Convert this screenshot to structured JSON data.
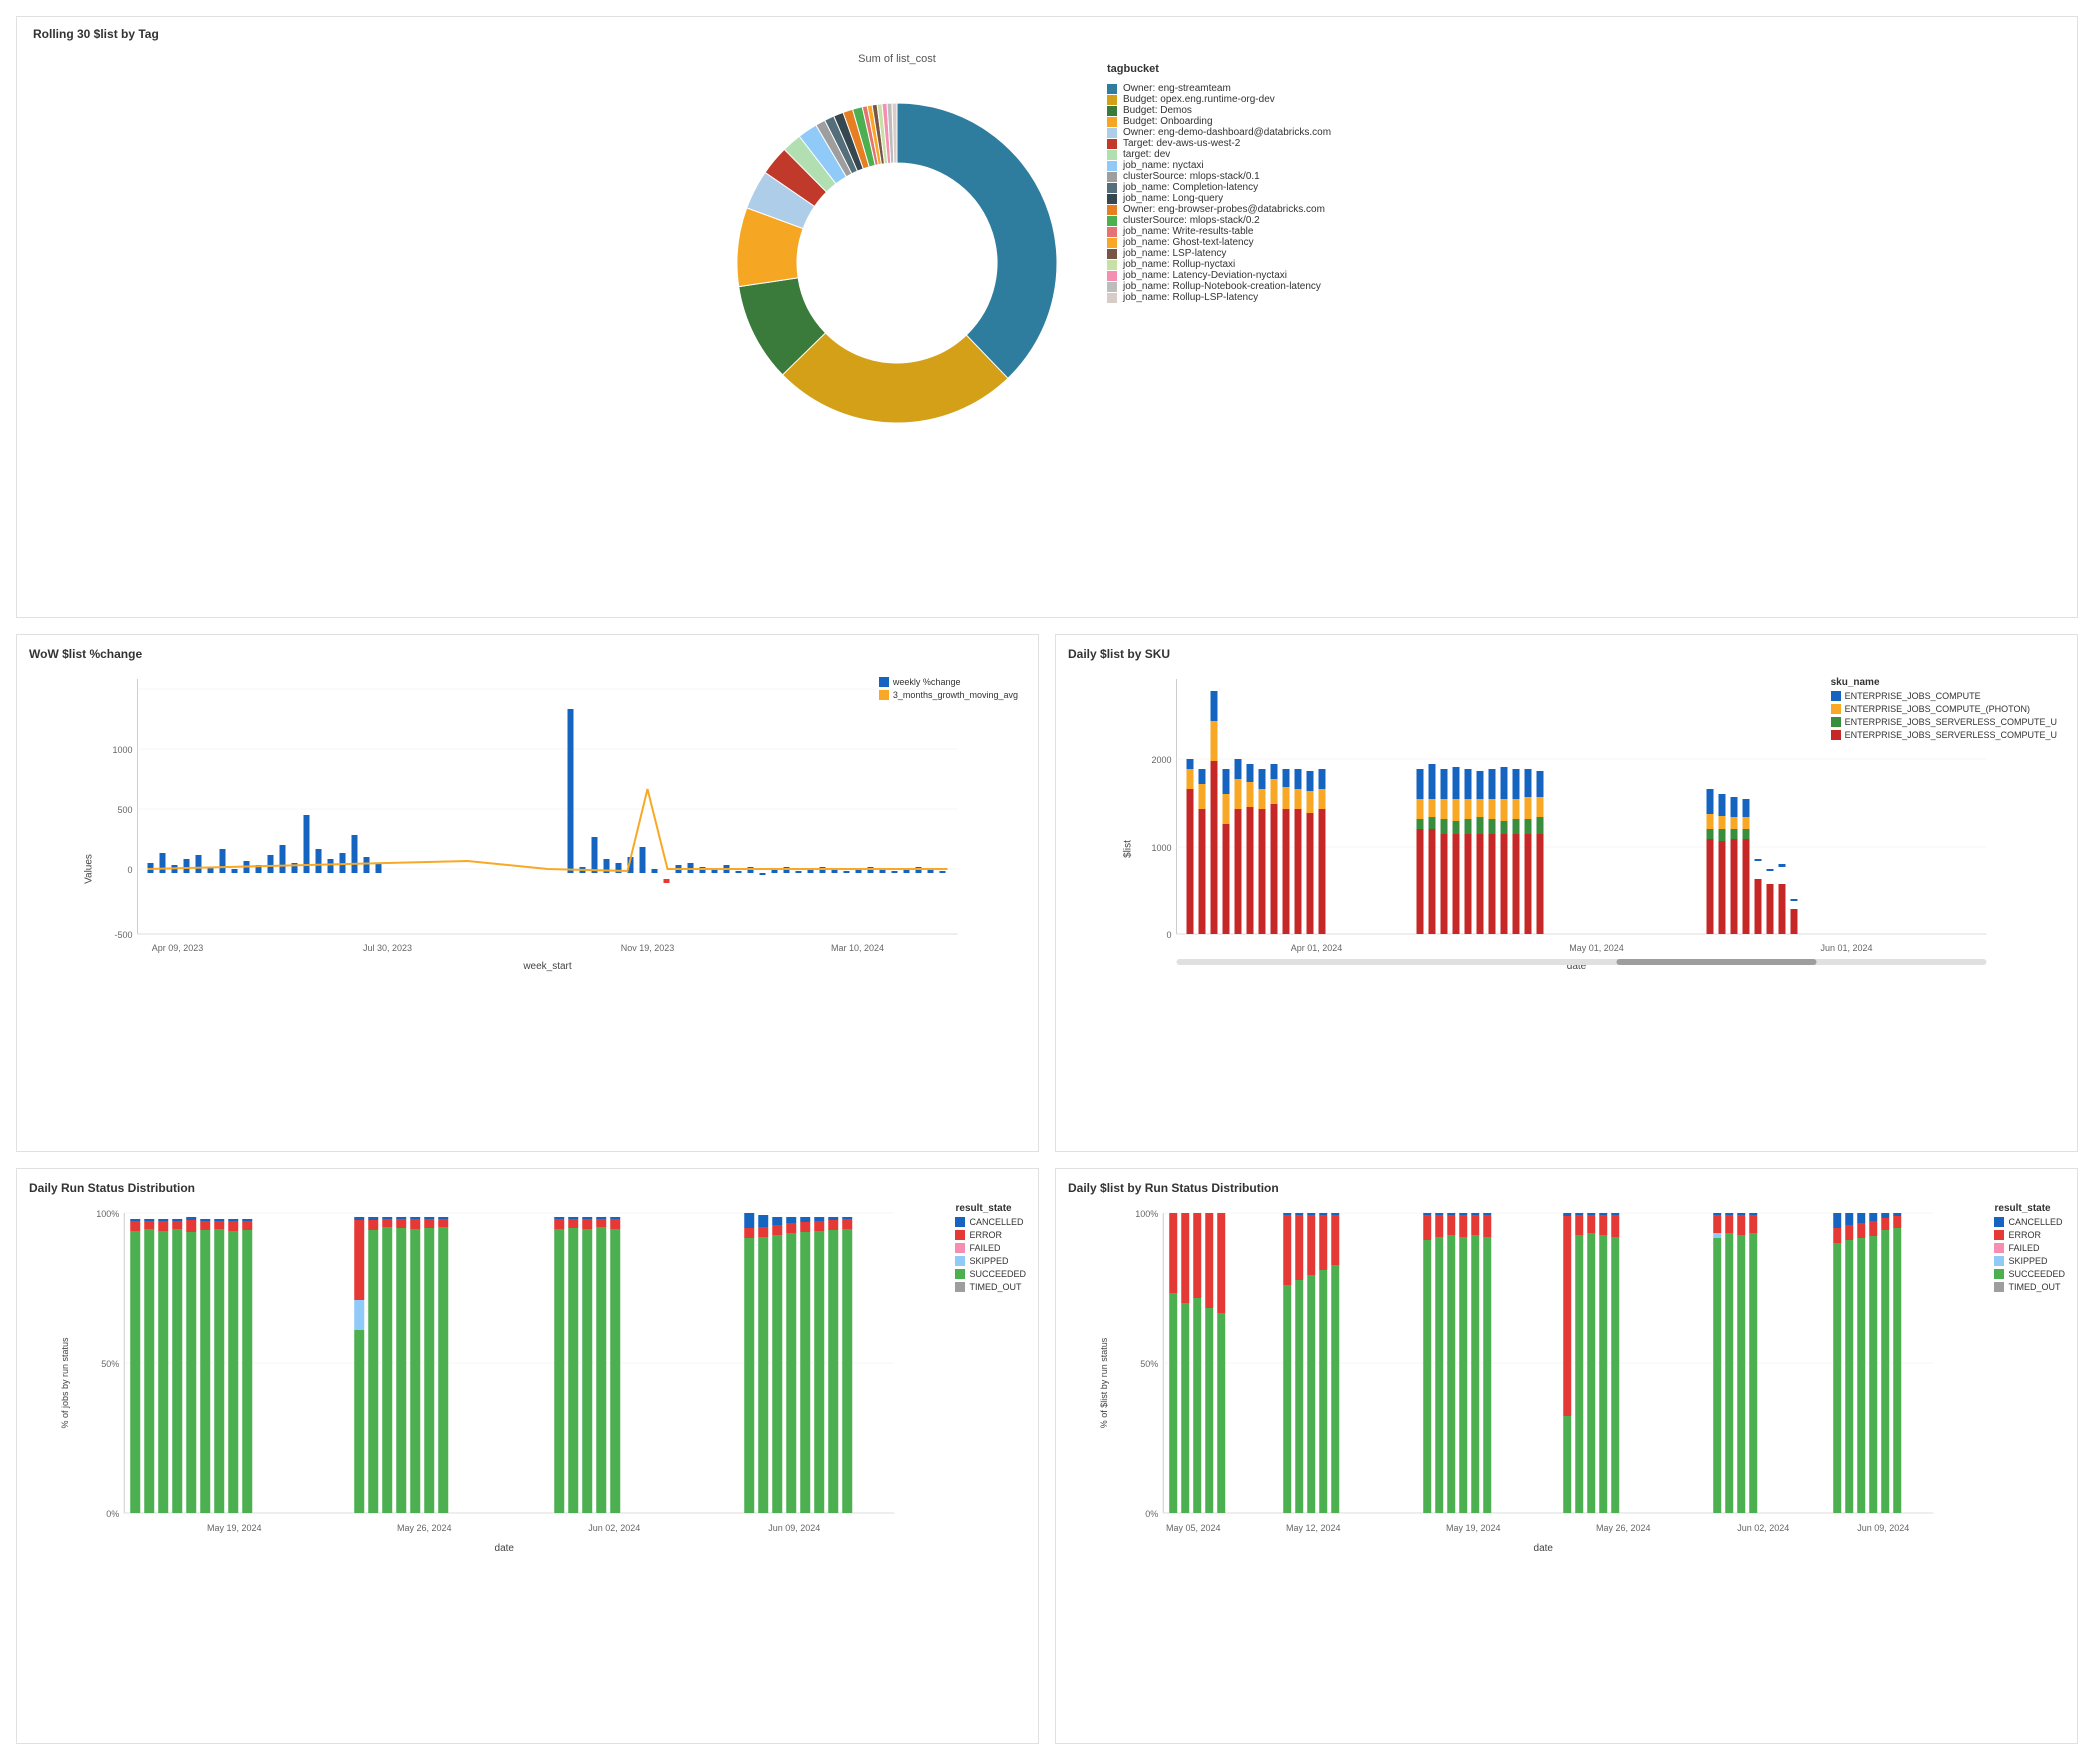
{
  "topChart": {
    "title": "Rolling 30 $list by Tag",
    "subtitle": "Sum of list_cost",
    "legend_title": "tagbucket",
    "legend_items": [
      {
        "label": "Owner: eng-streamteam",
        "color": "#2e7d9e"
      },
      {
        "label": "Budget: opex.eng.runtime-org-dev",
        "color": "#d4a017"
      },
      {
        "label": "Budget: Demos",
        "color": "#3a7a3a"
      },
      {
        "label": "Budget: Onboarding",
        "color": "#f5a623"
      },
      {
        "label": "Owner: eng-demo-dashboard@databricks.com",
        "color": "#aecde8"
      },
      {
        "label": "Target: dev-aws-us-west-2",
        "color": "#c0392b"
      },
      {
        "label": "target: dev",
        "color": "#b2dfb2"
      },
      {
        "label": "job_name: nyctaxi",
        "color": "#90caf9"
      },
      {
        "label": "clusterSource: mlops-stack/0.1",
        "color": "#9e9e9e"
      },
      {
        "label": "job_name: Completion-latency",
        "color": "#546e7a"
      },
      {
        "label": "job_name: Long-query",
        "color": "#37474f"
      },
      {
        "label": "Owner: eng-browser-probes@databricks.com",
        "color": "#e67e22"
      },
      {
        "label": "clusterSource: mlops-stack/0.2",
        "color": "#4caf50"
      },
      {
        "label": "job_name: Write-results-table",
        "color": "#e57373"
      },
      {
        "label": "job_name: Ghost-text-latency",
        "color": "#f9a825"
      },
      {
        "label": "job_name: LSP-latency",
        "color": "#795548"
      },
      {
        "label": "job_name: Rollup-nyctaxi",
        "color": "#c5e1a5"
      },
      {
        "label": "job_name: Latency-Deviation-nyctaxi",
        "color": "#f48fb1"
      },
      {
        "label": "job_name: Rollup-Notebook-creation-latency",
        "color": "#bdbdbd"
      },
      {
        "label": "job_name: Rollup-LSP-latency",
        "color": "#d7ccc8"
      }
    ],
    "donut_segments": [
      {
        "color": "#2e7d9e",
        "pct": 38
      },
      {
        "color": "#d4a017",
        "pct": 25
      },
      {
        "color": "#3a7a3a",
        "pct": 10
      },
      {
        "color": "#f5a623",
        "pct": 8
      },
      {
        "color": "#aecde8",
        "pct": 4
      },
      {
        "color": "#c0392b",
        "pct": 3
      },
      {
        "color": "#b2dfb2",
        "pct": 2
      },
      {
        "color": "#90caf9",
        "pct": 2
      },
      {
        "color": "#9e9e9e",
        "pct": 1
      },
      {
        "color": "#546e7a",
        "pct": 1
      },
      {
        "color": "#37474f",
        "pct": 1
      },
      {
        "color": "#e67e22",
        "pct": 1
      },
      {
        "color": "#4caf50",
        "pct": 1
      },
      {
        "color": "#e57373",
        "pct": 0.5
      },
      {
        "color": "#f9a825",
        "pct": 0.5
      },
      {
        "color": "#795548",
        "pct": 0.5
      },
      {
        "color": "#c5e1a5",
        "pct": 0.5
      },
      {
        "color": "#f48fb1",
        "pct": 0.5
      },
      {
        "color": "#bdbdbd",
        "pct": 0.5
      },
      {
        "color": "#d7ccc8",
        "pct": 0.5
      }
    ]
  },
  "wowChart": {
    "title": "WoW $list %change",
    "x_title": "week_start",
    "y_title": "Values",
    "legend": [
      {
        "label": "weekly %change",
        "color": "#1565c0"
      },
      {
        "label": "3_months_growth_moving_avg",
        "color": "#f9a825"
      }
    ],
    "x_labels": [
      "Apr 09, 2023",
      "Jul 30, 2023",
      "Nov 19, 2023",
      "Mar 10, 2024"
    ],
    "y_labels": [
      "-500",
      "0",
      "500",
      "1000"
    ]
  },
  "skuChart": {
    "title": "Daily $list by SKU",
    "x_title": "date",
    "y_title": "$list",
    "legend_title": "sku_name",
    "legend": [
      {
        "label": "ENTERPRISE_JOBS_COMPUTE",
        "color": "#1565c0"
      },
      {
        "label": "ENTERPRISE_JOBS_COMPUTE_(PHOTON)",
        "color": "#f9a825"
      },
      {
        "label": "ENTERPRISE_JOBS_SERVERLESS_COMPUTE_U",
        "color": "#388e3c"
      },
      {
        "label": "ENTERPRISE_JOBS_SERVERLESS_COMPUTE_U",
        "color": "#c62828"
      }
    ],
    "x_labels": [
      "Apr 01, 2024",
      "May 01, 2024",
      "Jun 01, 2024"
    ],
    "y_labels": [
      "0",
      "1000",
      "2000"
    ]
  },
  "runStatusChart": {
    "title": "Daily Run Status Distribution",
    "x_title": "date",
    "y_title": "% of jobs by run status",
    "legend_title": "result_state",
    "legend": [
      {
        "label": "CANCELLED",
        "color": "#1565c0"
      },
      {
        "label": "ERROR",
        "color": "#e53935"
      },
      {
        "label": "FAILED",
        "color": "#f48fb1"
      },
      {
        "label": "SKIPPED",
        "color": "#90caf9"
      },
      {
        "label": "SUCCEEDED",
        "color": "#4caf50"
      },
      {
        "label": "TIMED_OUT",
        "color": "#9e9e9e"
      }
    ],
    "x_labels": [
      "May 19, 2024",
      "May 26, 2024",
      "Jun 02, 2024",
      "Jun 09, 2024"
    ],
    "y_labels": [
      "0%",
      "50%",
      "100%"
    ]
  },
  "listByRunChart": {
    "title": "Daily $list by Run Status Distribution",
    "x_title": "date",
    "y_title": "% of $list by run status",
    "legend_title": "result_state",
    "legend": [
      {
        "label": "CANCELLED",
        "color": "#1565c0"
      },
      {
        "label": "ERROR",
        "color": "#e53935"
      },
      {
        "label": "FAILED",
        "color": "#f48fb1"
      },
      {
        "label": "SKIPPED",
        "color": "#90caf9"
      },
      {
        "label": "SUCCEEDED",
        "color": "#4caf50"
      },
      {
        "label": "TIMED_OUT",
        "color": "#9e9e9e"
      }
    ],
    "x_labels": [
      "May 05, 2024",
      "May 12, 2024",
      "May 19, 2024",
      "May 26, 2024",
      "Jun 02, 2024",
      "Jun 09, 2024"
    ],
    "y_labels": [
      "0%",
      "50%",
      "100%"
    ]
  }
}
